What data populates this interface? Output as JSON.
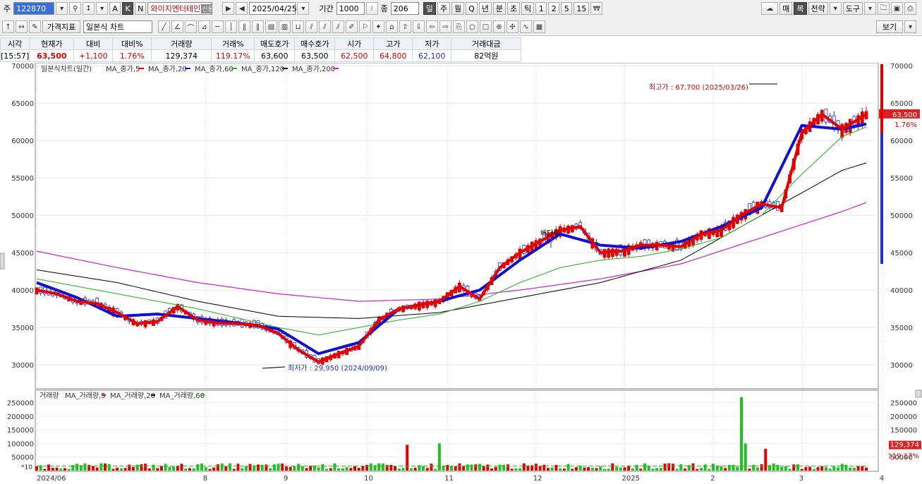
{
  "toolbar": {
    "stock_label": "주",
    "code": "122870",
    "name": "와이지엔터테인",
    "name_badge": "신용대",
    "date": "2025/04/25",
    "period_label": "기간",
    "period_value": "1000",
    "count_label": "종",
    "count_value": "206",
    "buttons_left": [
      "A",
      "K",
      "N"
    ],
    "periods": [
      "일",
      "주",
      "월",
      "Q",
      "년",
      "분",
      "초",
      "틱",
      "1",
      "2",
      "5",
      "15"
    ],
    "right_buttons": [
      "매",
      "복",
      "전략",
      "도구"
    ]
  },
  "toolbar2": {
    "price_indicator": "가격지표",
    "chart_type": "일본식 차트",
    "view_button": "보기"
  },
  "quote": {
    "headers": [
      "시각",
      "현재가",
      "대비",
      "대비%",
      "거래량",
      "거래%",
      "매도호가",
      "매수호가",
      "시가",
      "고가",
      "저가",
      "거래대금"
    ],
    "values": [
      "[15:57]",
      "63,500",
      "+1,100",
      "1.76%",
      "129,374",
      "119.17%",
      "63,600",
      "63,500",
      "62,500",
      "64,800",
      "62,100",
      "82억원"
    ]
  },
  "colors": {
    "up": "#e00000",
    "down": "#2030d0",
    "ma5": "#e00000",
    "ma20": "#1010d0",
    "ma60": "#20b020",
    "ma120": "#000000",
    "ma200": "#d020d0",
    "vol_up": "#e00000",
    "vol_down": "#20c020"
  },
  "chart_data": [
    {
      "type": "line",
      "title": "일본식차트(일간)",
      "legend": [
        "MA_종가,5",
        "MA_종가,20",
        "MA_종가,60",
        "MA_종가,120",
        "MA_종가,200"
      ],
      "ylim": [
        27000,
        70000
      ],
      "yticks": [
        30000,
        35000,
        40000,
        45000,
        50000,
        55000,
        60000,
        65000,
        70000
      ],
      "xticks": [
        "2024/06",
        "8",
        "9",
        "10",
        "11",
        "12",
        "2025",
        "2",
        "3",
        "4"
      ],
      "series": [
        {
          "name": "MA_종가,5",
          "x": [
            0,
            5,
            10,
            15,
            20,
            25,
            30,
            35,
            40,
            45,
            50,
            55,
            60,
            65,
            70,
            75,
            80,
            85,
            90,
            95,
            100,
            105,
            110,
            115,
            120,
            125,
            130,
            135,
            140,
            145,
            150,
            155,
            160,
            165,
            170,
            175,
            180,
            185,
            190,
            195,
            200,
            206
          ],
          "values": [
            40000,
            39500,
            38500,
            38200,
            37000,
            35500,
            35800,
            37800,
            36000,
            35600,
            35500,
            35300,
            34200,
            32000,
            30400,
            31500,
            32500,
            36000,
            37500,
            38000,
            38500,
            40500,
            38800,
            43000,
            45000,
            46500,
            48000,
            48500,
            45000,
            45200,
            46000,
            46000,
            45800,
            47500,
            48000,
            50000,
            51500,
            51000,
            61000,
            63500,
            61500,
            63500
          ]
        },
        {
          "name": "MA_종가,20",
          "x": [
            0,
            10,
            20,
            30,
            40,
            50,
            60,
            70,
            80,
            90,
            100,
            110,
            120,
            130,
            140,
            150,
            160,
            170,
            180,
            190,
            200,
            206
          ],
          "values": [
            41000,
            39000,
            36500,
            36800,
            36200,
            35600,
            34800,
            31500,
            33000,
            37500,
            38500,
            40000,
            44000,
            47500,
            46000,
            45600,
            46500,
            48500,
            51000,
            62000,
            61500,
            62200
          ]
        },
        {
          "name": "MA_종가,60",
          "x": [
            0,
            20,
            40,
            60,
            70,
            80,
            90,
            100,
            110,
            120,
            130,
            140,
            150,
            160,
            170,
            180,
            190,
            200,
            206
          ],
          "values": [
            41500,
            39500,
            37500,
            35000,
            34000,
            35000,
            36000,
            36800,
            38500,
            41000,
            43000,
            44000,
            44500,
            45500,
            47000,
            50000,
            55500,
            60500,
            61800
          ]
        },
        {
          "name": "MA_종가,120",
          "x": [
            0,
            20,
            40,
            60,
            80,
            100,
            120,
            140,
            160,
            180,
            200,
            206
          ],
          "values": [
            42700,
            41000,
            38500,
            36500,
            36200,
            37000,
            39000,
            41000,
            44000,
            50000,
            56000,
            57000
          ]
        },
        {
          "name": "MA_종가,200",
          "x": [
            0,
            20,
            40,
            60,
            80,
            100,
            120,
            140,
            160,
            180,
            200,
            206
          ],
          "values": [
            45200,
            43000,
            41000,
            39500,
            38500,
            38800,
            40000,
            41500,
            43500,
            47000,
            50500,
            51700
          ]
        }
      ],
      "annotations": [
        {
          "text": "최고가 : 67,700 (2025/03/26)",
          "x": 185,
          "y": 67700
        },
        {
          "text": "최저가 : 29,950 (2024/09/09)",
          "x": 65,
          "y": 29950
        },
        {
          "text": "배당락",
          "x": 150,
          "y": 46500
        }
      ],
      "last_price_label": "63,500",
      "last_change_label": "1.76%"
    },
    {
      "type": "bar",
      "title": "거래량",
      "legend": [
        "MA_거래량,5",
        "MA_거래량,20",
        "MA_거래량,60"
      ],
      "ylim": [
        0,
        280000
      ],
      "yticks": [
        50000,
        100000,
        150000,
        200000,
        250000
      ],
      "scale_note": "*10",
      "spikes": [
        {
          "x": 92,
          "value": 95000
        },
        {
          "x": 100,
          "value": 100000
        },
        {
          "x": 175,
          "value": 270000
        },
        {
          "x": 176,
          "value": 100000
        },
        {
          "x": 181,
          "value": 80000
        }
      ],
      "typical_volume": 15000,
      "last_volume_label": "129,374",
      "last_volume_pct_label": "119.17%"
    }
  ]
}
